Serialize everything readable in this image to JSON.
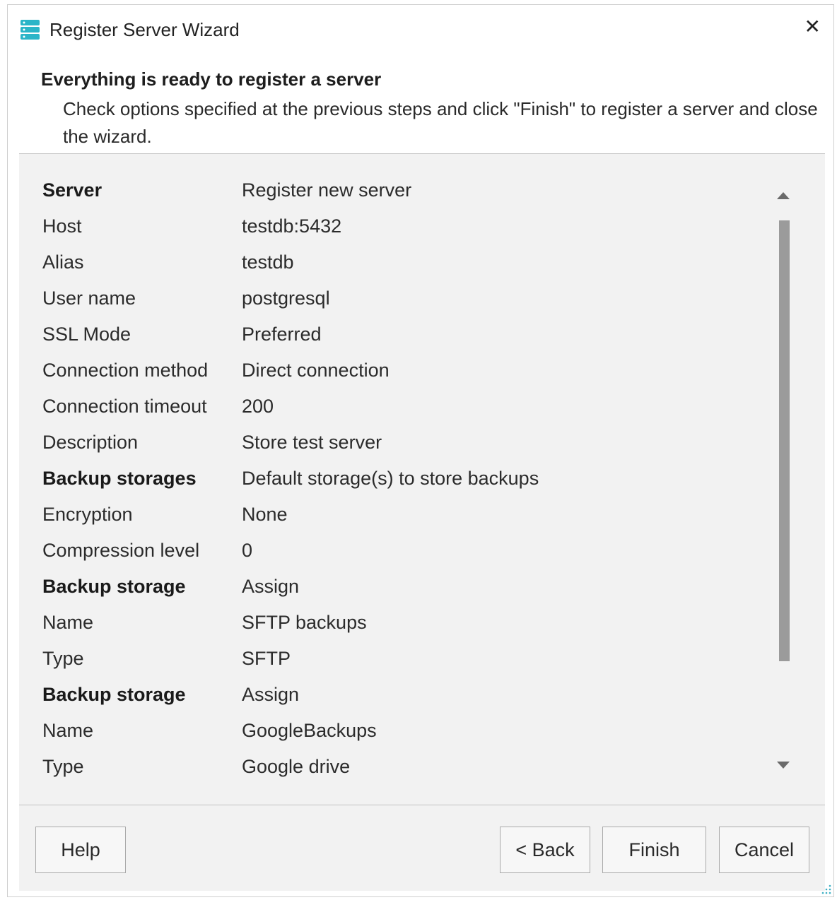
{
  "window": {
    "title": "Register Server Wizard"
  },
  "header": {
    "heading": "Everything is ready to register a server",
    "description": "Check options specified at the previous steps and click \"Finish\" to register a server and close the wizard."
  },
  "summary": [
    {
      "key": "Server",
      "value": "Register new server",
      "section": true
    },
    {
      "key": "Host",
      "value": "testdb:5432",
      "section": false
    },
    {
      "key": "Alias",
      "value": "testdb",
      "section": false
    },
    {
      "key": "User name",
      "value": "postgresql",
      "section": false
    },
    {
      "key": "SSL Mode",
      "value": "Preferred",
      "section": false
    },
    {
      "key": "Connection method",
      "value": "Direct connection",
      "section": false
    },
    {
      "key": "Connection timeout",
      "value": "200",
      "section": false
    },
    {
      "key": "Description",
      "value": "Store test server",
      "section": false
    },
    {
      "key": "Backup storages",
      "value": "Default storage(s) to store backups",
      "section": true
    },
    {
      "key": "Encryption",
      "value": "None",
      "section": false
    },
    {
      "key": "Compression level",
      "value": "0",
      "section": false
    },
    {
      "key": "Backup storage",
      "value": "Assign",
      "section": true
    },
    {
      "key": "Name",
      "value": "SFTP backups",
      "section": false
    },
    {
      "key": "Type",
      "value": "SFTP",
      "section": false
    },
    {
      "key": "Backup storage",
      "value": "Assign",
      "section": true
    },
    {
      "key": "Name",
      "value": "GoogleBackups",
      "section": false
    },
    {
      "key": "Type",
      "value": "Google drive",
      "section": false
    }
  ],
  "buttons": {
    "help": "Help",
    "back": "< Back",
    "finish": "Finish",
    "cancel": "Cancel"
  },
  "icons": {
    "app": "database-server-icon",
    "close": "close-icon"
  },
  "colors": {
    "accent": "#2bb5c8",
    "panel": "#f2f2f2"
  }
}
